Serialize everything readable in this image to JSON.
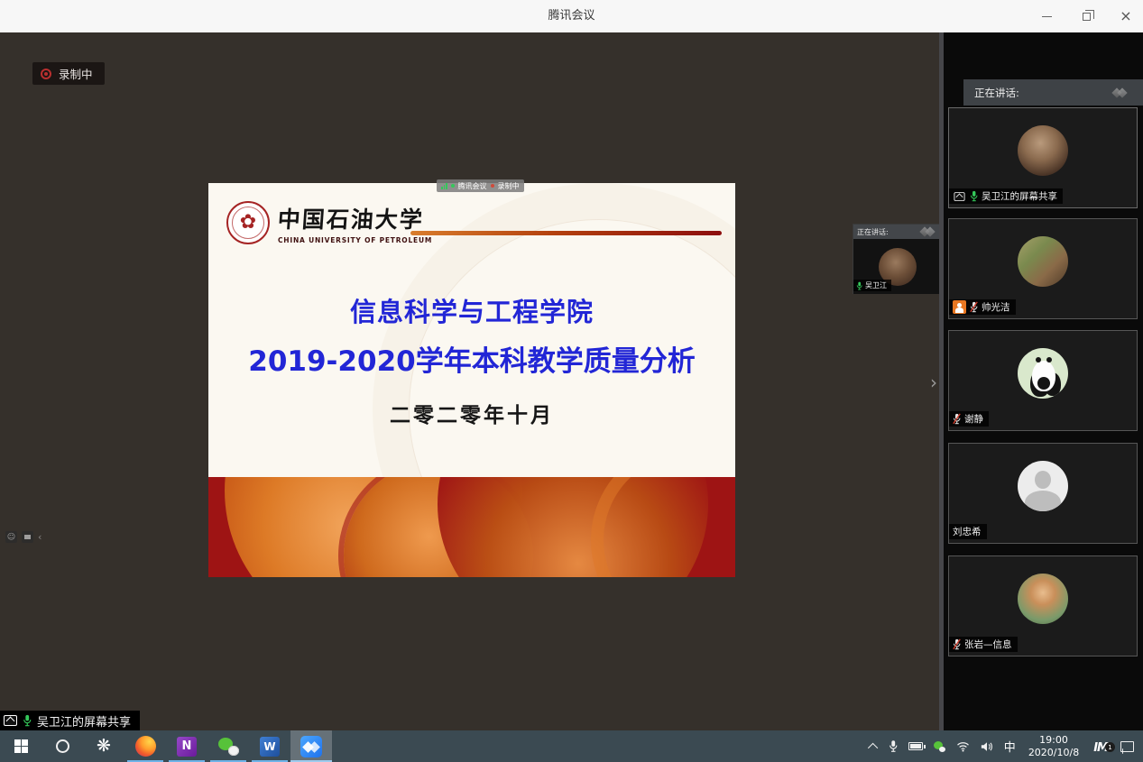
{
  "window": {
    "title": "腾讯会议"
  },
  "icons": {
    "pinwheel": "❋",
    "stage_chevron": "›",
    "mini_emoji": "☺",
    "mini_chevron": "‹",
    "onenote_letter": "N",
    "word_letter": "W",
    "close": "×"
  },
  "stage": {
    "recording_badge": "录制中",
    "pill": {
      "meeting": "腾讯会议",
      "recording": "录制中"
    },
    "bottom_label": "吴卫江的屏幕共享"
  },
  "slide": {
    "university_cn": "中国石油大学",
    "university_en": "CHINA UNIVERSITY OF PETROLEUM",
    "title_line1": "信息科学与工程学院",
    "title_line2": "2019-2020学年本科教学质量分析",
    "date_line": "二零二零年十月"
  },
  "speaking_overlay": {
    "header": "正在讲话:",
    "speaker": "吴卫江"
  },
  "sidebar": {
    "header": "正在讲话:",
    "participants": [
      {
        "name": "吴卫江的屏幕共享",
        "mic": "on",
        "screenshare": true
      },
      {
        "name": "帅光洁",
        "mic": "muted",
        "badge": "person"
      },
      {
        "name": "谢静",
        "mic": "muted"
      },
      {
        "name": "刘忠希",
        "mic": "none"
      },
      {
        "name": "张岩—信息",
        "mic": "muted"
      }
    ]
  },
  "taskbar": {
    "apps": [
      {
        "name": "start"
      },
      {
        "name": "cortana"
      },
      {
        "name": "pinwheel-app"
      },
      {
        "name": "firefox",
        "running": true
      },
      {
        "name": "onenote",
        "running": true
      },
      {
        "name": "wechat",
        "running": true
      },
      {
        "name": "word",
        "running": true
      },
      {
        "name": "tencent-meeting",
        "running": true,
        "active": true
      }
    ],
    "ime_indicator": "中",
    "im_label": "IM",
    "im_badge": "1",
    "clock": {
      "time": "19:00",
      "date": "2020/10/8"
    }
  },
  "colors": {
    "slide_title_blue": "#2226d6",
    "recording_red": "#b92f2f",
    "mic_green": "#34c85a",
    "badge_orange": "#e87722",
    "taskbar_bg": "#3b4a52",
    "meeting_blue": "#2d8cff"
  }
}
